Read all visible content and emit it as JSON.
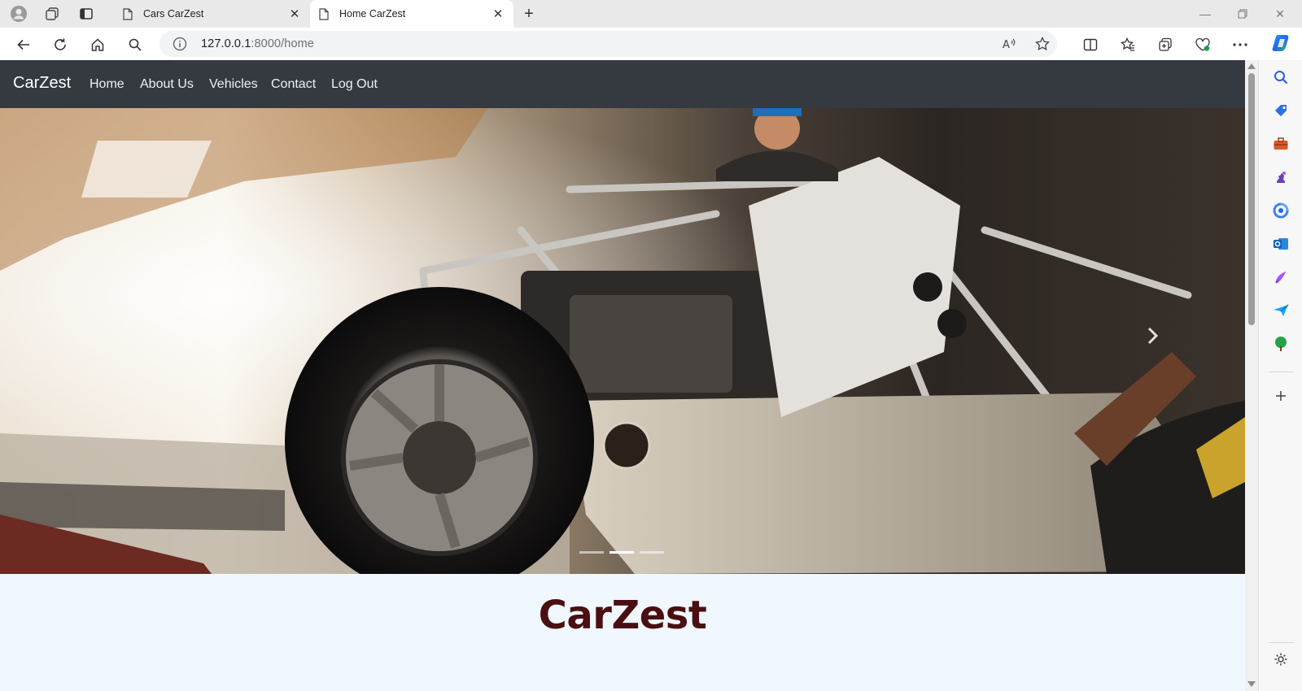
{
  "browser": {
    "tabs": [
      {
        "title": "Cars CarZest",
        "active": false
      },
      {
        "title": "Home CarZest",
        "active": true
      }
    ],
    "address": {
      "host": "127.0.0.1",
      "path": ":8000/home"
    }
  },
  "site": {
    "brand": "CarZest",
    "nav": [
      "Home",
      "About Us",
      "Vehicles",
      "Contact",
      "Log Out"
    ],
    "heading": "CarZest",
    "carousel": {
      "slides": 3,
      "active_slide": 2
    }
  },
  "colors": {
    "navbar": "#343a40",
    "page_background": "#f0f7ff",
    "heading": "#4a0f12"
  },
  "sidebar_icons": [
    "search-icon",
    "tag-icon",
    "briefcase-icon",
    "games-icon",
    "microsoft-365-icon",
    "outlook-icon",
    "designer-icon",
    "send-icon",
    "tree-icon",
    "add-icon",
    "settings-icon"
  ]
}
